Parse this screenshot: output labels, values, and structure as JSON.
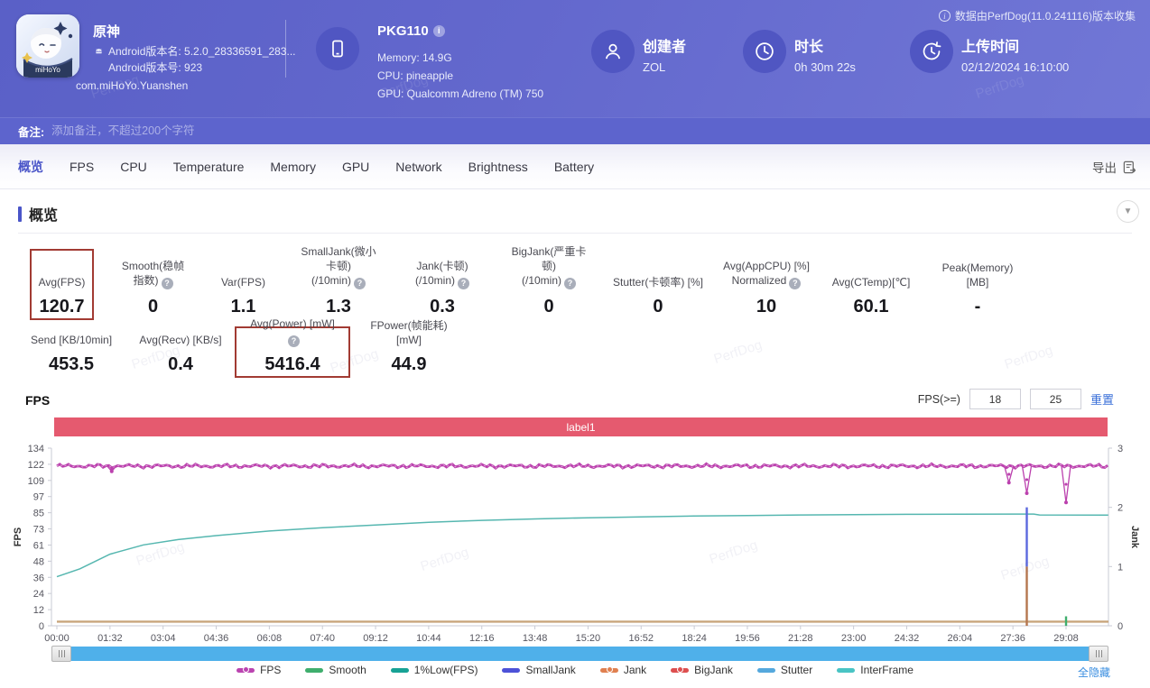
{
  "watermark": "PerfDog",
  "header": {
    "collect_note": "数据由PerfDog(11.0.241116)版本收集",
    "app": {
      "name": "原神",
      "icon_caption": "miHoYo",
      "android_version_name": "Android版本名: 5.2.0_28336591_283...",
      "android_version_code": "Android版本号: 923",
      "package": "com.miHoYo.Yuanshen"
    },
    "device": {
      "name": "PKG110",
      "memory": "Memory: 14.9G",
      "cpu": "CPU: pineapple",
      "gpu": "GPU: Qualcomm Adreno (TM) 750"
    },
    "creator": {
      "label": "创建者",
      "value": "ZOL"
    },
    "duration": {
      "label": "时长",
      "value": "0h 30m 22s"
    },
    "upload_time": {
      "label": "上传时间",
      "value": "02/12/2024 16:10:00"
    }
  },
  "note_bar": {
    "label": "备注:",
    "placeholder": "添加备注，不超过200个字符"
  },
  "tab_bar": {
    "tabs": [
      "概览",
      "FPS",
      "CPU",
      "Temperature",
      "Memory",
      "GPU",
      "Network",
      "Brightness",
      "Battery"
    ],
    "active_tab": "概览",
    "export_label": "导出"
  },
  "overview": {
    "section_title": "概览",
    "metrics_row1": [
      {
        "lines": [
          "Avg(FPS)"
        ],
        "value": "120.7",
        "help": false,
        "highlight": true
      },
      {
        "lines": [
          "Smooth(稳帧指数)"
        ],
        "value": "0",
        "help": true,
        "highlight": false
      },
      {
        "lines": [
          "Var(FPS)"
        ],
        "value": "1.1",
        "help": false,
        "highlight": false
      },
      {
        "lines": [
          "SmallJank(微小卡顿)",
          "(/10min)"
        ],
        "value": "1.3",
        "help": true,
        "highlight": false
      },
      {
        "lines": [
          "Jank(卡顿)",
          "(/10min)"
        ],
        "value": "0.3",
        "help": true,
        "highlight": false
      },
      {
        "lines": [
          "BigJank(严重卡顿)",
          "(/10min)"
        ],
        "value": "0",
        "help": true,
        "highlight": false
      },
      {
        "lines": [
          "Stutter(卡顿率) [%]"
        ],
        "value": "0",
        "help": false,
        "highlight": false
      },
      {
        "lines": [
          "Avg(AppCPU) [%]",
          "Normalized"
        ],
        "value": "10",
        "help": true,
        "highlight": false
      },
      {
        "lines": [
          "Avg(CTemp)[℃]"
        ],
        "value": "60.1",
        "help": false,
        "highlight": false
      },
      {
        "lines": [
          "Peak(Memory) [MB]"
        ],
        "value": "-",
        "help": false,
        "highlight": false
      }
    ],
    "metrics_row2": [
      {
        "lines": [
          "Send [KB/10min]"
        ],
        "value": "453.5",
        "help": false,
        "highlight": false
      },
      {
        "lines": [
          "Avg(Recv) [KB/s]"
        ],
        "value": "0.4",
        "help": false,
        "highlight": false
      },
      {
        "lines": [
          "Avg(Power) [mW]"
        ],
        "value": "5416.4",
        "help": true,
        "highlight": true
      },
      {
        "lines": [
          "FPower(帧能耗) [mW]"
        ],
        "value": "44.9",
        "help": false,
        "highlight": false
      }
    ]
  },
  "fps_section": {
    "title": "FPS",
    "filter_label": "FPS(>=)",
    "threshold_low": "18",
    "threshold_high": "25",
    "reset_label": "重置",
    "hide_all_label": "全隐藏"
  },
  "chart_data": {
    "type": "line",
    "title": "label1",
    "x_axis": {
      "unit": "mm:ss",
      "tick_interval_s": 92,
      "ticks": [
        "00:00",
        "01:32",
        "03:04",
        "04:36",
        "06:08",
        "07:40",
        "09:12",
        "10:44",
        "12:16",
        "13:48",
        "15:20",
        "16:52",
        "18:24",
        "19:56",
        "21:28",
        "23:00",
        "24:32",
        "26:04",
        "27:36",
        "29:08"
      ],
      "domain_s": [
        0,
        1821
      ]
    },
    "y_left": {
      "label": "FPS",
      "domain": [
        0,
        134
      ],
      "ticks": [
        0,
        12,
        24,
        36,
        48,
        61,
        73,
        85,
        97,
        109,
        122,
        134
      ]
    },
    "y_right": {
      "label": "Jank",
      "domain": [
        0,
        3
      ],
      "ticks": [
        0,
        1,
        2,
        3
      ]
    },
    "series": [
      {
        "name": "1%Low(FPS)",
        "axis": "left",
        "type": "curve",
        "color": "#56b7b0",
        "points": [
          [
            0,
            37
          ],
          [
            40,
            43
          ],
          [
            92,
            54
          ],
          [
            150,
            61
          ],
          [
            210,
            65
          ],
          [
            276,
            68
          ],
          [
            368,
            71.5
          ],
          [
            460,
            74
          ],
          [
            552,
            76
          ],
          [
            644,
            78
          ],
          [
            736,
            79.5
          ],
          [
            828,
            80.6
          ],
          [
            920,
            81.5
          ],
          [
            1012,
            82.2
          ],
          [
            1104,
            82.8
          ],
          [
            1196,
            83.2
          ],
          [
            1288,
            83.6
          ],
          [
            1380,
            83.9
          ],
          [
            1472,
            84.1
          ],
          [
            1564,
            84.2
          ],
          [
            1660,
            84.3
          ],
          [
            1692,
            84.3
          ],
          [
            1702,
            83.6
          ],
          [
            1821,
            83.5
          ]
        ]
      },
      {
        "name": "InterFrame",
        "axis": "right",
        "type": "flat",
        "value": 0.07,
        "color": "#c8a57c"
      },
      {
        "name": "SmallJank",
        "axis": "right",
        "type": "vline",
        "at": 1680,
        "from": 1,
        "to": 2,
        "color": "#5b68de"
      },
      {
        "name": "Jank",
        "axis": "right",
        "type": "vline",
        "at": 1680,
        "from": 0,
        "to": 1,
        "color": "#b5764f"
      },
      {
        "name": "Smooth",
        "axis": "right",
        "type": "vline",
        "at": 1748,
        "from": 0,
        "to": 0.16,
        "color": "#3fae6d"
      },
      {
        "name": "FPS",
        "axis": "left",
        "type": "noisy-flat",
        "base": 120.5,
        "color": "#bb41ae",
        "dips": [
          [
            95,
            116.5
          ],
          [
            1649,
            108
          ],
          [
            1680,
            100
          ],
          [
            1748,
            93
          ]
        ]
      }
    ],
    "legend": [
      {
        "label": "FPS",
        "color": "#bb44b0",
        "dot": true
      },
      {
        "label": "Smooth",
        "color": "#3fae6d",
        "dot": false
      },
      {
        "label": "1%Low(FPS)",
        "color": "#17a295",
        "dot": false
      },
      {
        "label": "SmallJank",
        "color": "#4d52d8",
        "dot": false
      },
      {
        "label": "Jank",
        "color": "#e08050",
        "dot": true
      },
      {
        "label": "BigJank",
        "color": "#dd4f4f",
        "dot": true
      },
      {
        "label": "Stutter",
        "color": "#55a8dd",
        "dot": false
      },
      {
        "label": "InterFrame",
        "color": "#49c4c4",
        "dot": false
      }
    ],
    "legend_position": "bottom",
    "grid": false
  }
}
